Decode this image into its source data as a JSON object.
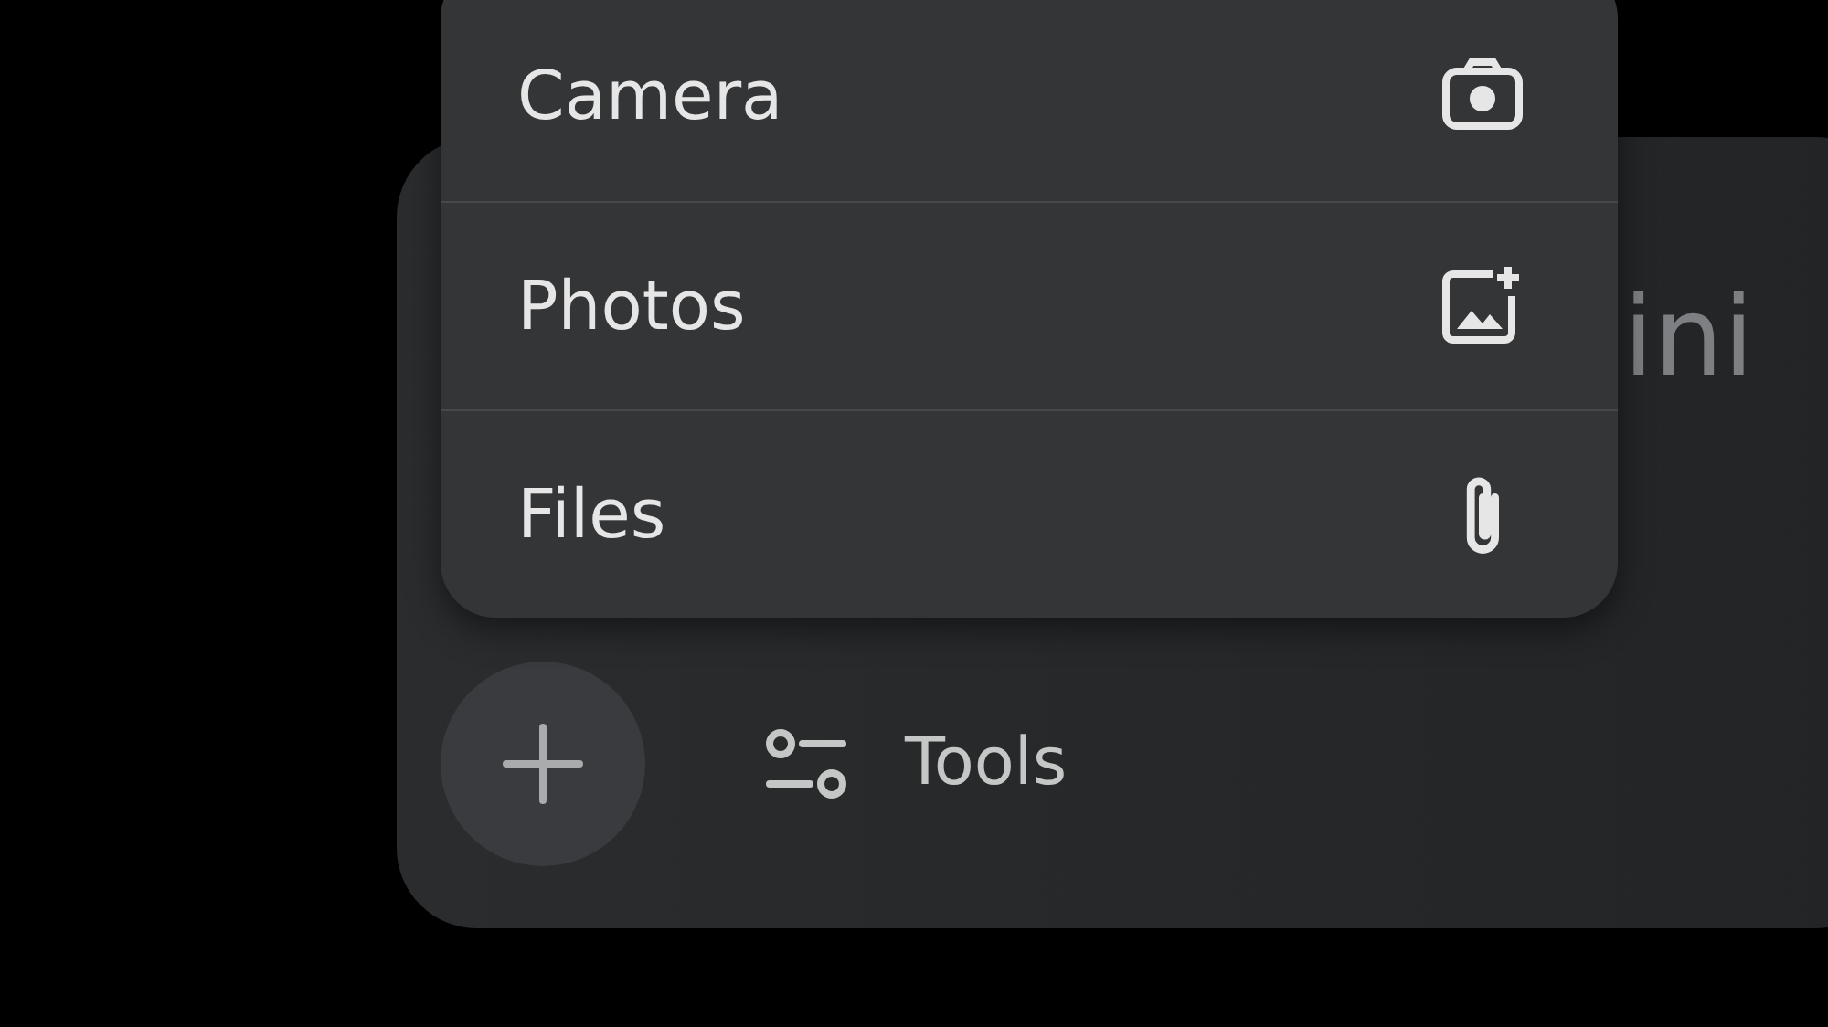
{
  "prompt_hint": "ini",
  "attach_menu": {
    "items": [
      {
        "label": "Camera",
        "kind": "camera"
      },
      {
        "label": "Photos",
        "kind": "photos"
      },
      {
        "label": "Files",
        "kind": "files"
      }
    ]
  },
  "toolbar": {
    "tools_label": "Tools"
  }
}
